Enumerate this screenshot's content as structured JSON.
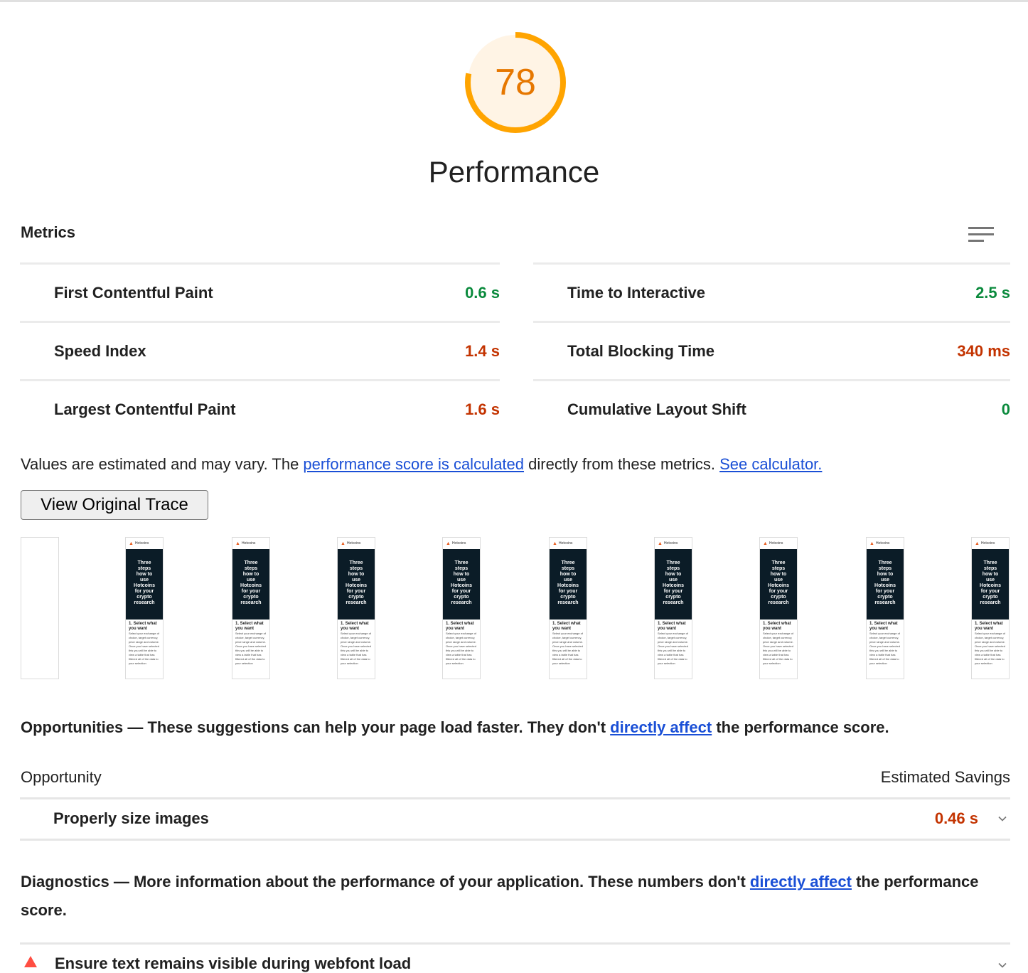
{
  "score": {
    "value": 78,
    "label": "78",
    "fraction": 0.78,
    "color": "#ffa400",
    "text_color": "#e67700",
    "category": "Performance"
  },
  "metrics": {
    "header": "Metrics",
    "toggle_icon": "list-view-icon",
    "left": [
      {
        "label": "First Contentful Paint",
        "value": "0.6 s",
        "status": "good"
      },
      {
        "label": "Speed Index",
        "value": "1.4 s",
        "status": "average"
      },
      {
        "label": "Largest Contentful Paint",
        "value": "1.6 s",
        "status": "average"
      }
    ],
    "right": [
      {
        "label": "Time to Interactive",
        "value": "2.5 s",
        "status": "good"
      },
      {
        "label": "Total Blocking Time",
        "value": "340 ms",
        "status": "average"
      },
      {
        "label": "Cumulative Layout Shift",
        "value": "0",
        "status": "good"
      }
    ],
    "colors": {
      "good": "#0a8a3c",
      "average": "#c33300"
    }
  },
  "note": {
    "prefix": "Values are estimated and may vary. The ",
    "link1": "performance score is calculated",
    "middle": " directly from these metrics. ",
    "link2": "See calculator."
  },
  "trace_button": "View Original Trace",
  "filmstrip": {
    "frame_header": "Hotcoins",
    "hero_text": [
      "Three",
      "steps",
      "how to",
      "use",
      "Hotcoins",
      "for your",
      "crypto",
      "research"
    ],
    "step_title": "1. Select what you want",
    "step_body": "Select your exchange of choice, target currency, price range and volume. Once you have selected this you will be able to view a table that has filtered all of the data to your selection"
  },
  "opportunities": {
    "title": "Opportunities",
    "dash": " — ",
    "desc_prefix": "These suggestions can help your page load faster. They don't ",
    "desc_link": "directly affect",
    "desc_suffix": " the performance score.",
    "col_left": "Opportunity",
    "col_right": "Estimated Savings",
    "items": [
      {
        "label": "Properly size images",
        "value": "0.46 s"
      }
    ]
  },
  "diagnostics": {
    "title": "Diagnostics",
    "dash": " — ",
    "desc_prefix": "More information about the performance of your application. These numbers don't ",
    "desc_link": "directly affect",
    "desc_suffix": " the performance score.",
    "items": [
      {
        "label": "Ensure text remains visible during webfont load",
        "icon": "warning-triangle-icon",
        "color": "#ff4e42"
      }
    ]
  }
}
